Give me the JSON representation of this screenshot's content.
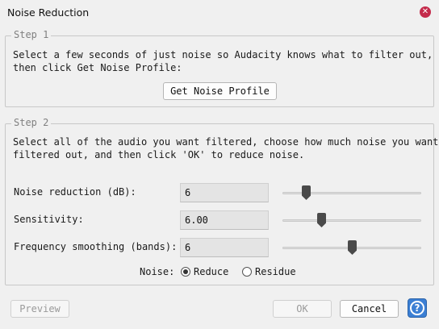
{
  "window": {
    "title": "Noise Reduction",
    "close_glyph": "✕"
  },
  "step1": {
    "legend": "Step 1",
    "line1": "Select a few seconds of just noise so Audacity knows what to filter out,",
    "line2": "then click Get Noise Profile:",
    "button": "Get Noise Profile"
  },
  "step2": {
    "legend": "Step 2",
    "line1": "Select all of the audio you want filtered, choose how much noise you want",
    "line2": "filtered out, and then click 'OK' to reduce noise.",
    "params": [
      {
        "label": "Noise reduction (dB):",
        "value": "6",
        "slider_fraction": 0.15
      },
      {
        "label": "Sensitivity:",
        "value": "6.00",
        "slider_fraction": 0.27
      },
      {
        "label": "Frequency smoothing (bands):",
        "value": "6",
        "slider_fraction": 0.5
      }
    ],
    "noise_label": "Noise:",
    "noise_options": [
      {
        "label": "Reduce",
        "selected": true
      },
      {
        "label": "Residue",
        "selected": false
      }
    ]
  },
  "footer": {
    "preview": "Preview",
    "ok": "OK",
    "cancel": "Cancel",
    "help_glyph": "?"
  },
  "colors": {
    "help_button": "#3b7fd4",
    "close_button": "#c42b4b"
  }
}
